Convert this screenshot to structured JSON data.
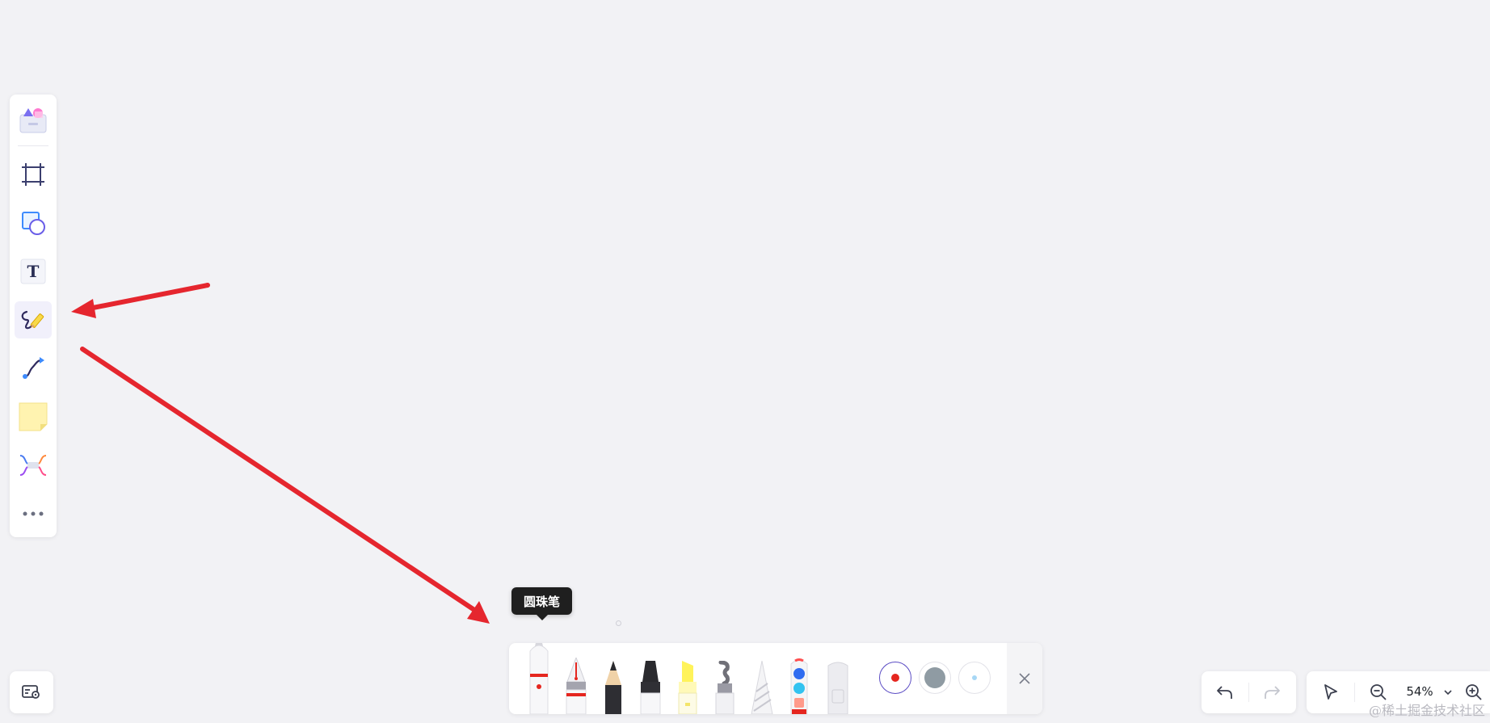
{
  "left_toolbar": {
    "items": [
      {
        "name": "templates",
        "icon": "templates-icon"
      },
      {
        "name": "frame",
        "icon": "frame-icon"
      },
      {
        "name": "shapes",
        "icon": "shapes-icon"
      },
      {
        "name": "text",
        "icon": "text-icon",
        "glyph": "T"
      },
      {
        "name": "pen",
        "icon": "pen-icon",
        "active": true
      },
      {
        "name": "connector",
        "icon": "connector-icon"
      },
      {
        "name": "sticky-note",
        "icon": "sticky-note-icon"
      },
      {
        "name": "mind-map",
        "icon": "mind-map-icon"
      },
      {
        "name": "more",
        "icon": "more-icon"
      }
    ]
  },
  "tooltip": {
    "text": "圆珠笔"
  },
  "pen_tray": {
    "pens": [
      {
        "name": "ballpoint",
        "icon": "ballpoint-pen-icon",
        "selected": true
      },
      {
        "name": "fountain",
        "icon": "fountain-pen-icon"
      },
      {
        "name": "pencil",
        "icon": "pencil-icon"
      },
      {
        "name": "marker",
        "icon": "marker-icon"
      },
      {
        "name": "highlighter",
        "icon": "highlighter-icon"
      },
      {
        "name": "laser",
        "icon": "laser-pointer-icon"
      },
      {
        "name": "texture",
        "icon": "texture-brush-icon"
      },
      {
        "name": "color-picker",
        "icon": "color-palette-icon"
      },
      {
        "name": "eraser",
        "icon": "eraser-icon"
      }
    ],
    "colors": [
      {
        "name": "red",
        "hex": "#e5261f",
        "selected": true
      },
      {
        "name": "gray",
        "hex": "#8f9ba3"
      },
      {
        "name": "light-blue",
        "hex": "#a7d7f5"
      }
    ]
  },
  "zoom": {
    "value": "54%"
  },
  "watermark": {
    "text": "@稀土掘金技术社区"
  },
  "colors": {
    "canvas": "#f2f2f5",
    "accent": "#5b4cc4",
    "annotation_arrow": "#e5262e"
  }
}
